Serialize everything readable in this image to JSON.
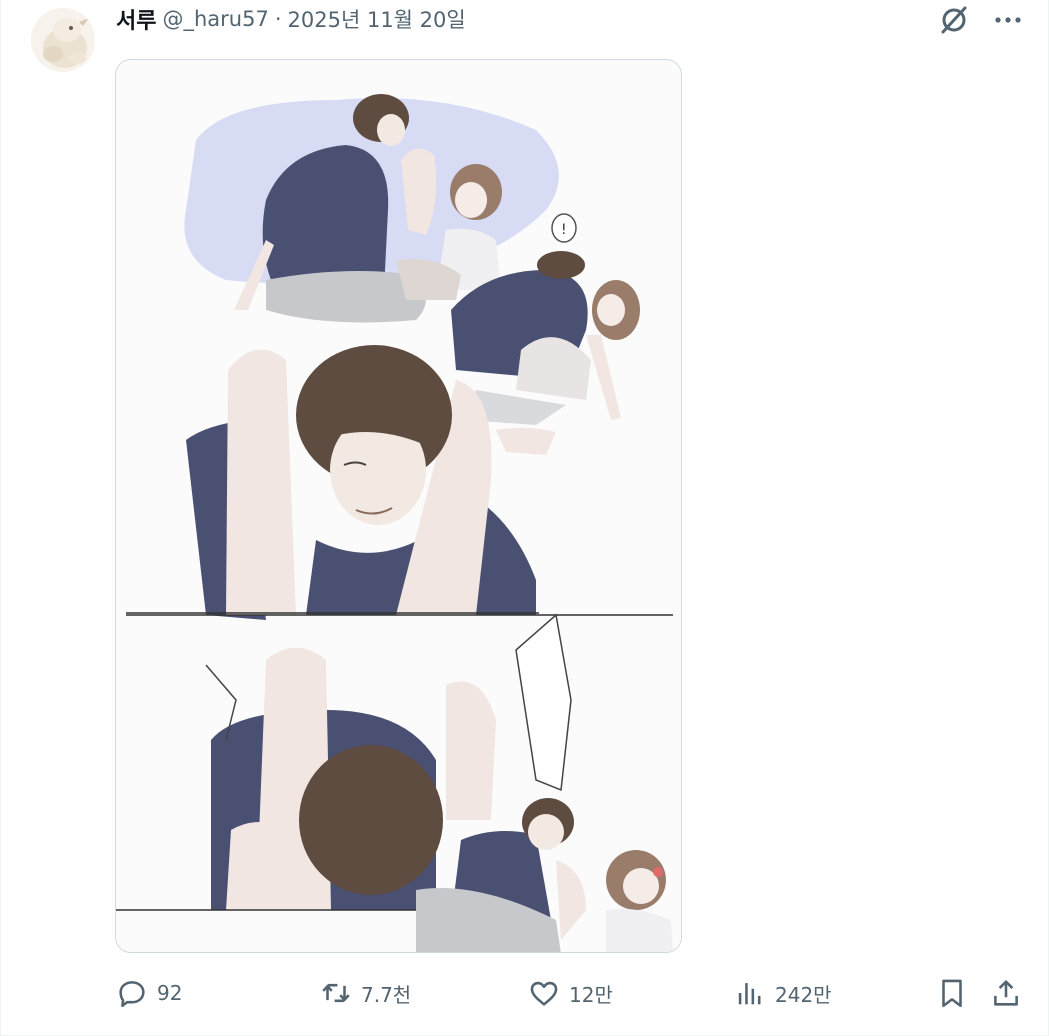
{
  "tweet": {
    "author_name": "서루",
    "handle": "@_haru57",
    "separator": "·",
    "date": "2025년 11월 20일"
  },
  "header_icons": [
    "grok-icon",
    "more-icon"
  ],
  "actions": {
    "reply_count": "92",
    "retweet_count": "7.7천",
    "like_count": "12만",
    "views_count": "242만"
  },
  "colors": {
    "text_primary": "#0f1419",
    "text_secondary": "#536471",
    "border": "#cfd9de",
    "shirt_navy": "#4a5072",
    "hair_brown": "#5e4c40",
    "skin": "#f1e6e1",
    "backdrop_lavender": "#d7dcf4"
  }
}
